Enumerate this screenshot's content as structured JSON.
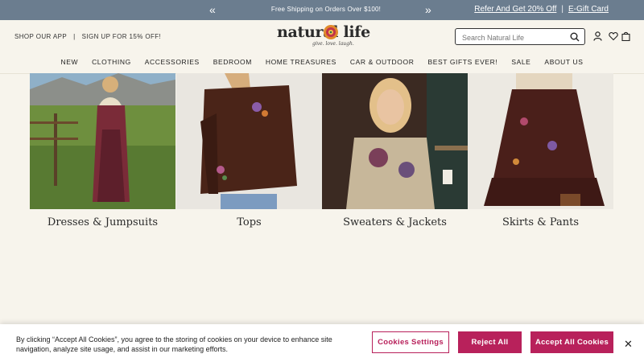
{
  "promo": {
    "message": "Free Shipping on Orders Over $100!",
    "prev_icon": "chevron-double-left",
    "next_icon": "chevron-double-right",
    "refer_link": "Refer And Get 20% Off",
    "gift_card_link": "E-Gift Card"
  },
  "header": {
    "shop_app": "SHOP OUR APP",
    "signup": "SIGN UP FOR 15% OFF!",
    "logo_word": "natural life",
    "logo_tagline": "give. love. laugh.",
    "search_placeholder": "Search Natural Life",
    "icons": [
      "account-icon",
      "heart-icon",
      "cart-icon"
    ]
  },
  "nav": {
    "items": [
      "NEW",
      "CLOTHING",
      "ACCESSORIES",
      "BEDROOM",
      "HOME TREASURES",
      "CAR & OUTDOOR",
      "BEST GIFTS EVER!",
      "SALE",
      "ABOUT US"
    ]
  },
  "categories": [
    {
      "label": "Dresses & Jumpsuits"
    },
    {
      "label": "Tops"
    },
    {
      "label": "Sweaters & Jackets"
    },
    {
      "label": "Skirts & Pants"
    }
  ],
  "cookie": {
    "text": "By clicking “Accept All Cookies”, you agree to the storing of cookies on your device to enhance site navigation, analyze site usage, and assist in our marketing efforts.",
    "settings": "Cookies Settings",
    "reject": "Reject All",
    "accept": "Accept All Cookies"
  },
  "colors": {
    "promo_bg": "#6b7d8f",
    "page_bg": "#f7f4ec",
    "accent": "#b8215b"
  }
}
